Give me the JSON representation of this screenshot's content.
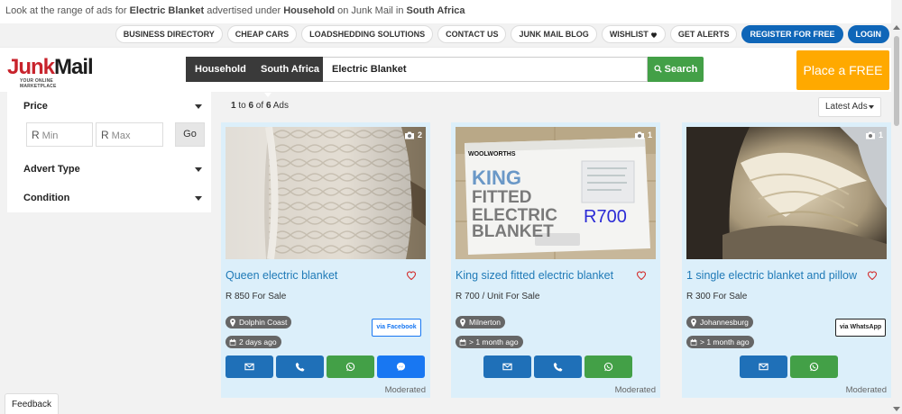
{
  "topline": {
    "prefix": "Look at the range of ads for ",
    "keyword": "Electric Blanket",
    "mid1": " advertised under ",
    "category": "Household",
    "mid2": " on Junk Mail in ",
    "location": "South Africa"
  },
  "nav": {
    "business_directory": "BUSINESS DIRECTORY",
    "cheap_cars": "CHEAP CARS",
    "loadshedding": "LOADSHEDDING SOLUTIONS",
    "contact_us": "CONTACT US",
    "blog": "JUNK MAIL BLOG",
    "wishlist": "WISHLIST",
    "alerts": "GET ALERTS",
    "register": "REGISTER FOR FREE",
    "login": "LOGIN"
  },
  "logo": {
    "junk": "Junk",
    "mail": "Mail",
    "tagline": "YOUR ONLINE MARKETPLACE"
  },
  "search": {
    "category": "Household",
    "region": "South Africa",
    "query": "Electric Blanket",
    "button": "Search"
  },
  "place_ad": "Place a FREE Ad",
  "filters": {
    "price": "Price",
    "currency": "R",
    "min_placeholder": "Min",
    "max_placeholder": "Max",
    "go": "Go",
    "advert_type": "Advert Type",
    "condition": "Condition"
  },
  "results": {
    "from": "1",
    "to_label": " to ",
    "to": "6",
    "of_label": " of ",
    "total": "6",
    "suffix": " Ads"
  },
  "sort": "Latest Ads",
  "listings": [
    {
      "title": "Queen electric blanket",
      "price": "R 850 For Sale",
      "photos": "2",
      "location": "Dolphin Coast",
      "age": "2 days ago",
      "via": "via Facebook",
      "status": "Moderated"
    },
    {
      "title": "King sized fitted electric blanket",
      "price": "R 700 / Unit For Sale",
      "photos": "1",
      "location": "Milnerton",
      "age": "> 1 month ago",
      "via": "",
      "status": "Moderated",
      "box_brand": "WOOLWORTHS",
      "box_line1": "KING",
      "box_line2": "FITTED",
      "box_line3": "ELECTRIC",
      "box_line4": "BLANKET",
      "box_price": "R700"
    },
    {
      "title": "1 single electric blanket and pillow",
      "price": "R 300 For Sale",
      "photos": "1",
      "location": "Johannesburg",
      "age": "> 1 month ago",
      "via": "via WhatsApp",
      "status": "Moderated"
    }
  ],
  "feedback": "Feedback",
  "colors": {
    "accent_blue": "#1f70b8",
    "brand_red": "#c8232c",
    "place_ad_orange": "#ffa900",
    "green": "#43a047",
    "card_bg": "#dceffa"
  }
}
